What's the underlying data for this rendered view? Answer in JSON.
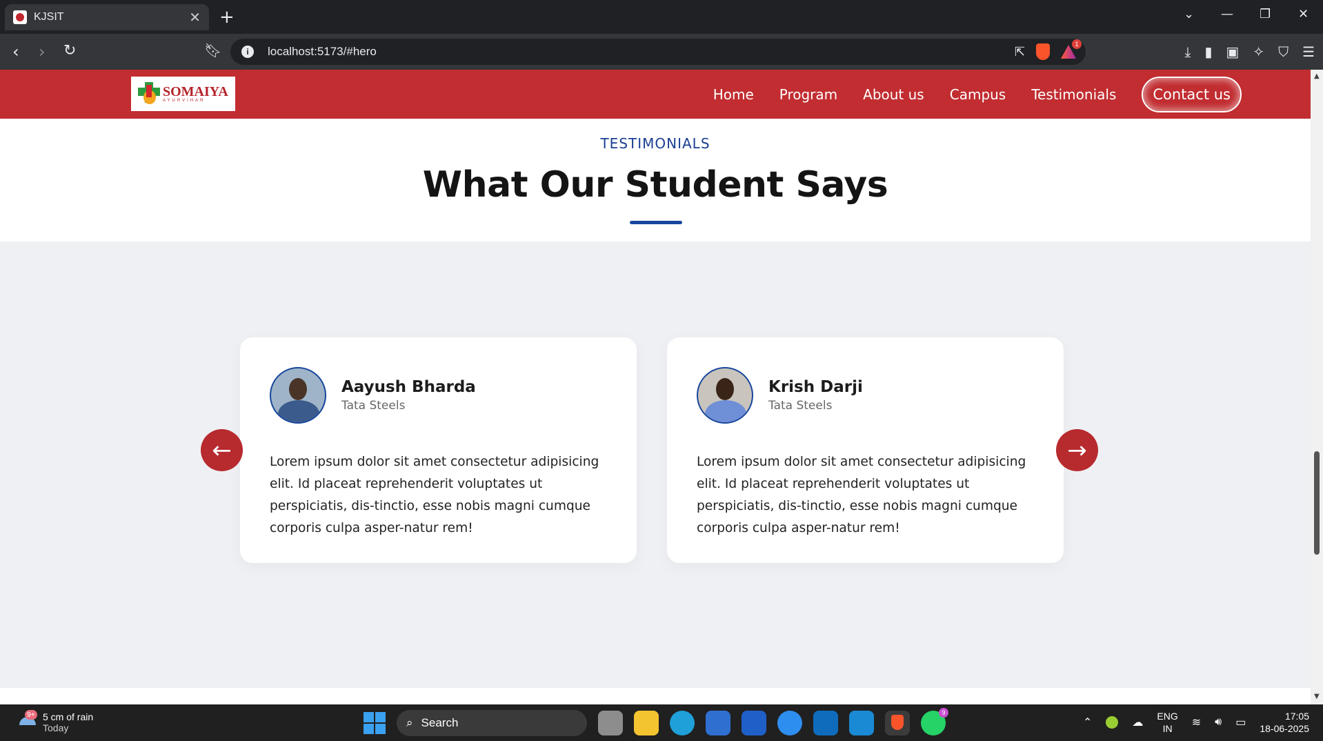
{
  "browser": {
    "tab_title": "KJSIT",
    "tab_close": "✕",
    "new_tab": "+",
    "url": "localhost:5173/#hero",
    "rewards_badge": "1",
    "window_controls": {
      "tab_search": "⌄",
      "minimize": "—",
      "restore": "❐",
      "close": "✕"
    }
  },
  "header": {
    "logo_text": "SOMAIYA",
    "logo_subtext": "AYURVIHAR",
    "nav": [
      "Home",
      "Program",
      "About us",
      "Campus",
      "Testimonials"
    ],
    "contact_label": "Contact us",
    "color": "#c12d31"
  },
  "section": {
    "eyebrow": "TESTIMONIALS",
    "title": "What Our Student Says",
    "accent_color": "#17469d"
  },
  "testimonials": [
    {
      "name": "Aayush Bharda",
      "company": "Tata Steels",
      "text": "Lorem ipsum dolor sit amet consectetur adipisicing elit. Id placeat reprehenderit voluptates ut perspiciatis, dis-tinctio, esse nobis magni cumque corporis culpa asper-natur rem!"
    },
    {
      "name": "Krish Darji",
      "company": "Tata Steels",
      "text": "Lorem ipsum dolor sit amet consectetur adipisicing elit. Id placeat reprehenderit voluptates ut perspiciatis, dis-tinctio, esse nobis magni cumque corporis culpa asper-natur rem!"
    }
  ],
  "carousel": {
    "prev_icon": "arrow-left-icon",
    "next_icon": "arrow-right-icon",
    "prev_glyph": "←",
    "next_glyph": "→"
  },
  "taskbar": {
    "weather_line1": "5 cm of rain",
    "weather_line2": "Today",
    "weather_badge": "9+",
    "search_placeholder": "Search",
    "whatsapp_badge": "9",
    "lang_line1": "ENG",
    "lang_line2": "IN",
    "time": "17:05",
    "date": "18-06-2025"
  }
}
